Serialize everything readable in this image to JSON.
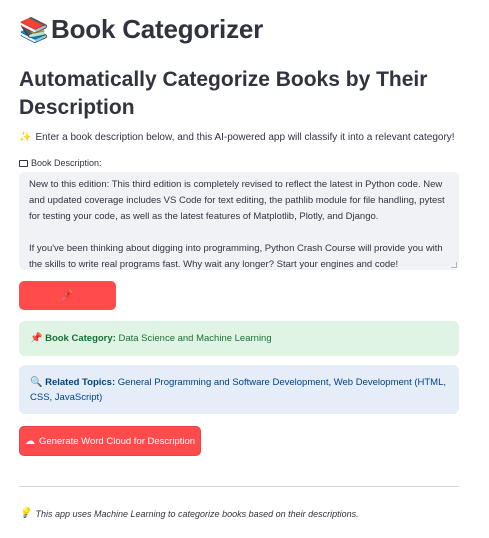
{
  "header": {
    "emoji": "📚",
    "title": "Book Categorizer"
  },
  "subtitle": "Automatically Categorize Books by Their Description",
  "intro": {
    "icon": "✨",
    "text": "Enter a book description below, and this AI-powered app will classify it into a relevant category!"
  },
  "description_field": {
    "label": "Book Description:",
    "value_paragraph_1": "New to this edition: This third edition is completely revised to reflect the latest in Python code. New and updated coverage includes VS Code for text editing, the pathlib module for file handling, pytest for testing your code, as well as the latest features of Matplotlib, Plotly, and Django.",
    "value_paragraph_2": "If you've been thinking about digging into programming, Python Crash Course will provide you with the skills to write real programs fast. Why wait any longer? Start your engines and code!"
  },
  "categorize_button": {
    "icon": "📌",
    "label": ""
  },
  "category_result": {
    "icon": "📌",
    "label": "Book Category:",
    "value": "Data Science and Machine Learning"
  },
  "topics_result": {
    "icon": "🔍",
    "label": "Related Topics:",
    "value": "General Programming and Software Development, Web Development (HTML, CSS, JavaScript)"
  },
  "wordcloud_button": {
    "icon": "☁",
    "label": "Generate Word Cloud for Description"
  },
  "footer": {
    "icon": "💡",
    "text": "This app uses Machine Learning to categorize books based on their descriptions."
  },
  "colors": {
    "primary": "#ff4b4b",
    "success_bg": "#dff4e4",
    "success_text": "#177233",
    "info_bg": "#e4edf8",
    "info_text": "#004280",
    "input_bg": "#f0f2f6"
  }
}
